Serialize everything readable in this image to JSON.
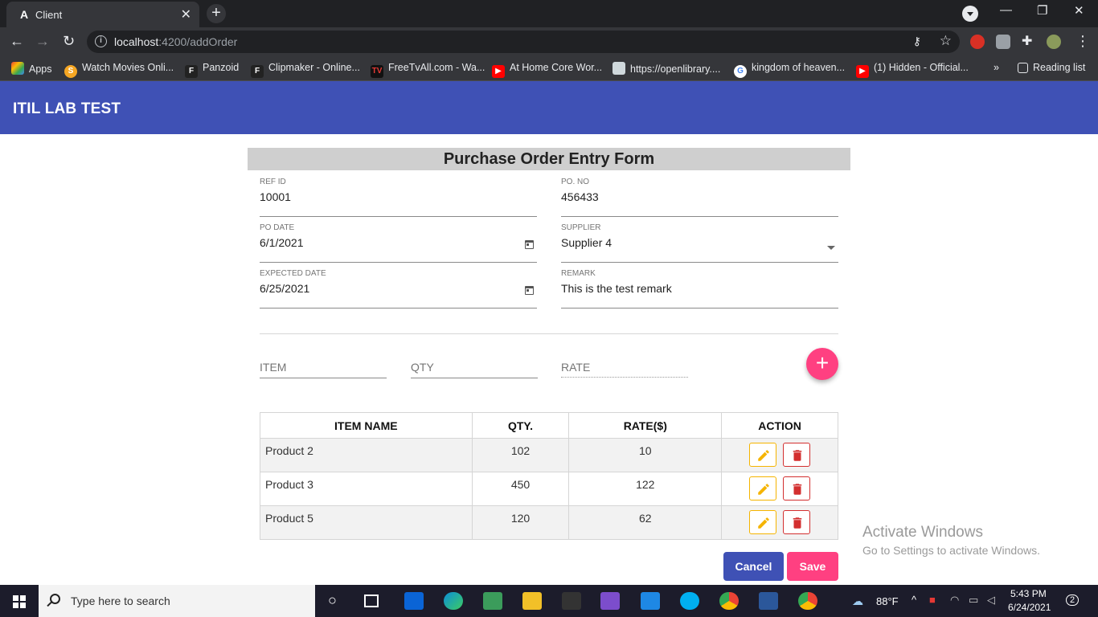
{
  "browser": {
    "tab_title": "Client",
    "url_host": "localhost",
    "url_path": ":4200/addOrder",
    "bookmarks": [
      "Apps",
      "Watch Movies Onli...",
      "Panzoid",
      "Clipmaker - Online...",
      "FreeTvAll.com - Wa...",
      "At Home Core Wor...",
      "https://openlibrary....",
      "kingdom of heaven...",
      "(1) Hidden - Official...",
      "Reading list"
    ]
  },
  "app": {
    "title": "ITIL LAB TEST"
  },
  "form": {
    "heading": "Purchase Order Entry Form",
    "ref_id": {
      "label": "REF ID",
      "value": "10001"
    },
    "po_no": {
      "label": "PO. NO",
      "value": "456433"
    },
    "po_date": {
      "label": "PO DATE",
      "value": "6/1/2021"
    },
    "supplier": {
      "label": "SUPPLIER",
      "value": "Supplier 4"
    },
    "expected_date": {
      "label": "EXPECTED DATE",
      "value": "6/25/2021"
    },
    "remark": {
      "label": "REMARK",
      "value": "This is the test remark"
    }
  },
  "item_entry": {
    "item_placeholder": "ITEM",
    "qty_placeholder": "QTY",
    "rate_placeholder": "RATE",
    "add_label": "+"
  },
  "table": {
    "headers": [
      "ITEM NAME",
      "QTY.",
      "RATE($)",
      "ACTION"
    ],
    "rows": [
      {
        "name": "Product 2",
        "qty": "102",
        "rate": "10"
      },
      {
        "name": "Product 3",
        "qty": "450",
        "rate": "122"
      },
      {
        "name": "Product 5",
        "qty": "120",
        "rate": "62"
      }
    ]
  },
  "actions": {
    "cancel": "Cancel",
    "save": "Save"
  },
  "watermark": {
    "line1": "Activate Windows",
    "line2": "Go to Settings to activate Windows."
  },
  "taskbar": {
    "search_placeholder": "Type here to search",
    "weather": "88°F",
    "time": "5:43 PM",
    "date": "6/24/2021",
    "notification_count": "2"
  },
  "colors": {
    "primary": "#3f51b5",
    "accent": "#ff4081",
    "edit": "#f5b400",
    "delete": "#d32f2f"
  }
}
